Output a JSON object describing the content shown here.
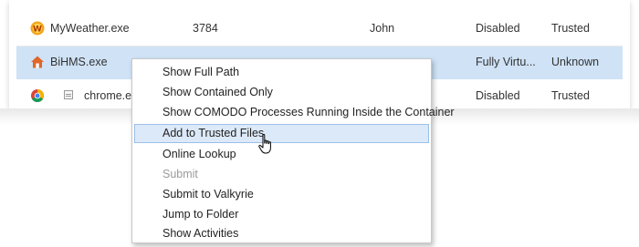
{
  "processes": [
    {
      "icon": "myweather-icon",
      "name": "MyWeather.exe",
      "pid": "3784",
      "user": "John",
      "status": "Disabled",
      "rating": "Trusted"
    },
    {
      "icon": "home-icon",
      "name": "BiHMS.exe",
      "pid": "",
      "user": "",
      "status": "Fully Virtu...",
      "rating": "Unknown"
    },
    {
      "icon": "chrome-icon",
      "name": "chrome.exe",
      "pid": "",
      "user": "",
      "status": "Disabled",
      "rating": "Trusted"
    }
  ],
  "context_menu": {
    "items": [
      {
        "label": "Show Full Path"
      },
      {
        "label": "Show Contained Only"
      },
      {
        "label": "Show COMODO Processes Running Inside the Container"
      },
      {
        "label": "Add to Trusted Files"
      },
      {
        "label": "Online Lookup"
      },
      {
        "label": "Submit"
      },
      {
        "label": "Submit to Valkyrie"
      },
      {
        "label": "Jump to Folder"
      },
      {
        "label": "Show Activities"
      }
    ]
  },
  "colors": {
    "selected_row": "#cfe2f6",
    "menu_hover": "#dce9f8",
    "menu_hover_border": "#9bbfe8",
    "disabled_text": "#9a9a9a"
  }
}
